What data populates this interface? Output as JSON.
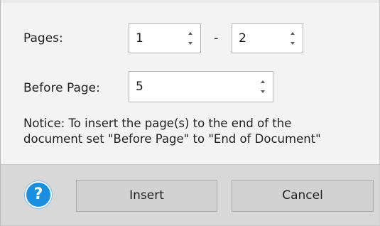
{
  "fields": {
    "pages_label": "Pages:",
    "pages_from": "1",
    "pages_separator": "-",
    "pages_to": "2",
    "before_page_label": "Before Page:",
    "before_page_value": "5"
  },
  "notice": {
    "line1": "Notice: To insert the page(s) to the end of the",
    "line2": "document set \"Before Page\" to \"End of Document\""
  },
  "footer": {
    "help_glyph": "?",
    "insert_label": "Insert",
    "cancel_label": "Cancel"
  },
  "colors": {
    "dialog_background": "#f3f3f3",
    "footer_background": "#d8d8d8",
    "help_accent": "#1a8fe0",
    "button_background": "#d2d2d2"
  },
  "icons": [
    "help-icon",
    "spin-up-icon",
    "spin-down-icon"
  ]
}
